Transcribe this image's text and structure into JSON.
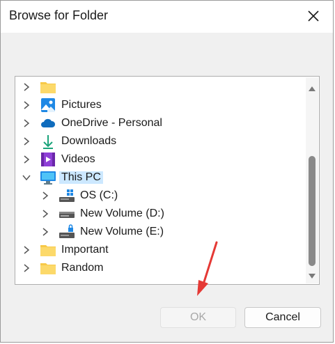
{
  "dialog": {
    "title": "Browse for Folder"
  },
  "tree": {
    "items": [
      {
        "label": "",
        "icon": "folder-icon"
      },
      {
        "label": "Pictures",
        "icon": "pictures-icon"
      },
      {
        "label": "OneDrive - Personal",
        "icon": "onedrive-cloud-icon"
      },
      {
        "label": "Downloads",
        "icon": "downloads-icon"
      },
      {
        "label": "Videos",
        "icon": "videos-icon"
      },
      {
        "label": "This PC",
        "icon": "this-pc-icon",
        "expanded": true,
        "selected": true
      },
      {
        "label": "OS (C:)",
        "icon": "drive-c-icon"
      },
      {
        "label": "New Volume (D:)",
        "icon": "drive-icon"
      },
      {
        "label": "New Volume (E:)",
        "icon": "drive-locked-icon"
      },
      {
        "label": "Important",
        "icon": "folder-icon"
      },
      {
        "label": "Random",
        "icon": "folder-icon"
      }
    ]
  },
  "buttons": {
    "ok": "OK",
    "cancel": "Cancel"
  },
  "colors": {
    "selection": "#cce8ff",
    "annotation_arrow": "#e53935"
  }
}
